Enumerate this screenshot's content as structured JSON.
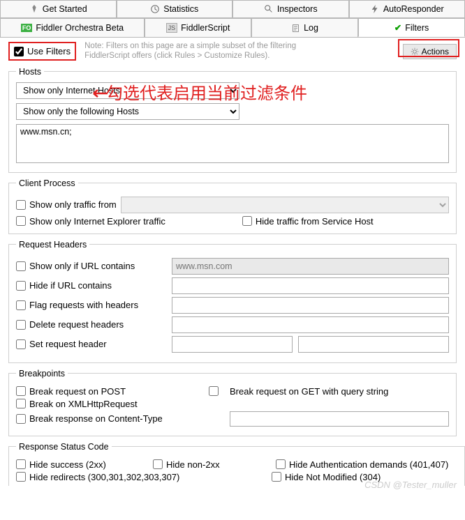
{
  "tabs_row1": [
    {
      "label": "Get Started",
      "icon": "rocket"
    },
    {
      "label": "Statistics",
      "icon": "clock"
    },
    {
      "label": "Inspectors",
      "icon": "magnifier"
    },
    {
      "label": "AutoResponder",
      "icon": "lightning"
    }
  ],
  "tabs_row2": [
    {
      "label": "Fiddler Orchestra Beta",
      "icon": "fo"
    },
    {
      "label": "FiddlerScript",
      "icon": "js"
    },
    {
      "label": "Log",
      "icon": "log"
    },
    {
      "label": "Filters",
      "icon": "check",
      "active": true
    }
  ],
  "use_filters_label": "Use Filters",
  "use_filters_checked": true,
  "note_line1": "Note: Filters on this page are a simple subset of the filtering",
  "note_line2": "FiddlerScript offers (click Rules > Customize Rules).",
  "actions_label": "Actions",
  "annotation": "勾选代表启用当前过滤条件",
  "hosts": {
    "legend": "Hosts",
    "zone_select": "Show only Internet Hosts",
    "hosts_select": "Show only the following Hosts",
    "hosts_textarea": "www.msn.cn;"
  },
  "client_process": {
    "legend": "Client Process",
    "show_only_traffic_from": "Show only traffic from",
    "show_only_ie_traffic": "Show only Internet Explorer traffic",
    "hide_service_host": "Hide traffic from Service Host"
  },
  "request_headers": {
    "legend": "Request Headers",
    "url_contains": "Show only if URL contains",
    "url_contains_value": "www.msn.com",
    "hide_url": "Hide if URL contains",
    "flag_headers": "Flag requests with headers",
    "delete_headers": "Delete request headers",
    "set_header": "Set request header"
  },
  "breakpoints": {
    "legend": "Breakpoints",
    "post": "Break request on POST",
    "get_query": "Break request on GET with query string",
    "xhr": "Break on XMLHttpRequest",
    "content_type": "Break response on Content-Type"
  },
  "response_status": {
    "legend": "Response Status Code",
    "hide_2xx": "Hide success (2xx)",
    "hide_non2xx": "Hide non-2xx",
    "hide_auth": "Hide Authentication demands (401,407)",
    "hide_redirect": "Hide redirects (300,301,302,303,307)",
    "hide_304": "Hide Not Modified (304)"
  },
  "watermark": "CSDN @Tester_muller"
}
